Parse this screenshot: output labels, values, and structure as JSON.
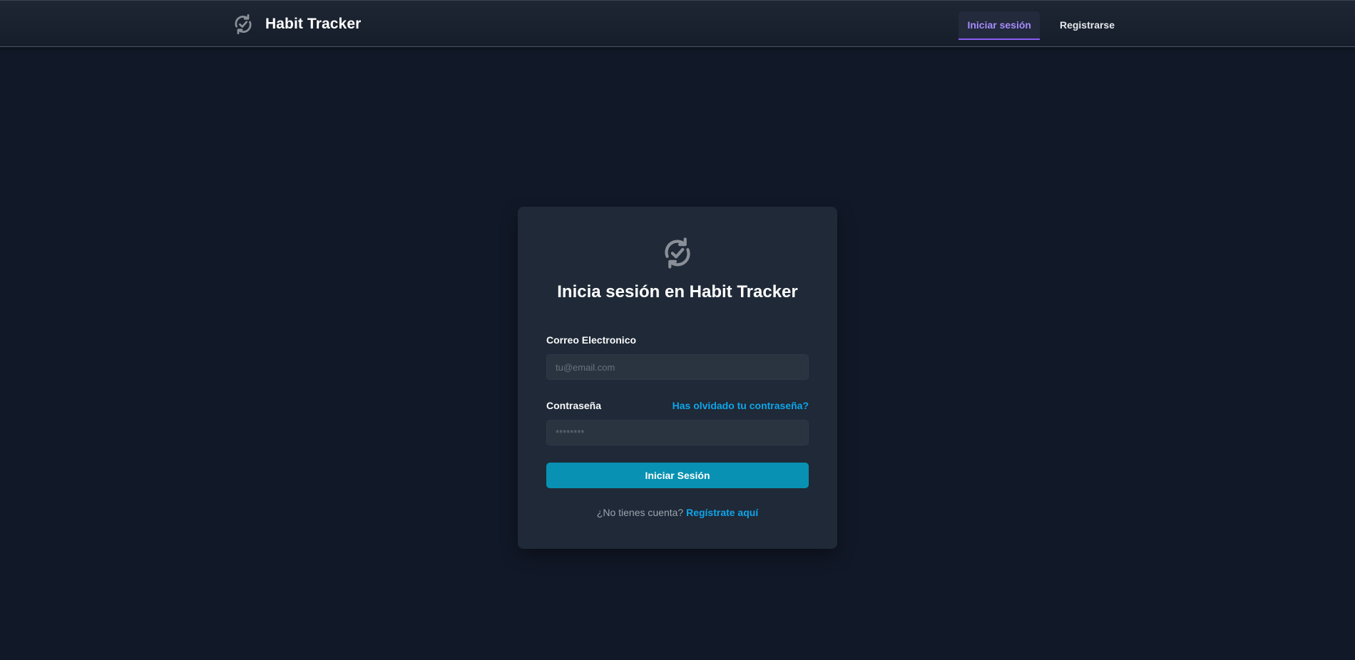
{
  "header": {
    "brand_icon": "sync-check-icon",
    "brand_name": "Habit Tracker",
    "nav": [
      {
        "label": "Iniciar sesión",
        "active": true
      },
      {
        "label": "Registrarse",
        "active": false
      }
    ]
  },
  "login": {
    "logo_icon": "sync-check-icon",
    "title": "Inicia sesión en Habit Tracker",
    "email_label": "Correo Electronico",
    "email_placeholder": "tu@email.com",
    "email_value": "",
    "password_label": "Contraseña",
    "password_placeholder": "********",
    "password_value": "",
    "forgot_link": "Has olvidado tu contraseña?",
    "submit_label": "Iniciar Sesión",
    "no_account_text": "¿No tienes cuenta?",
    "register_link": "Regístrate aquí"
  },
  "colors": {
    "background": "#111827",
    "card": "#1f2937",
    "accent_purple": "#8b5cf6",
    "accent_cyan": "#0891b2",
    "link": "#0ea5e9"
  }
}
